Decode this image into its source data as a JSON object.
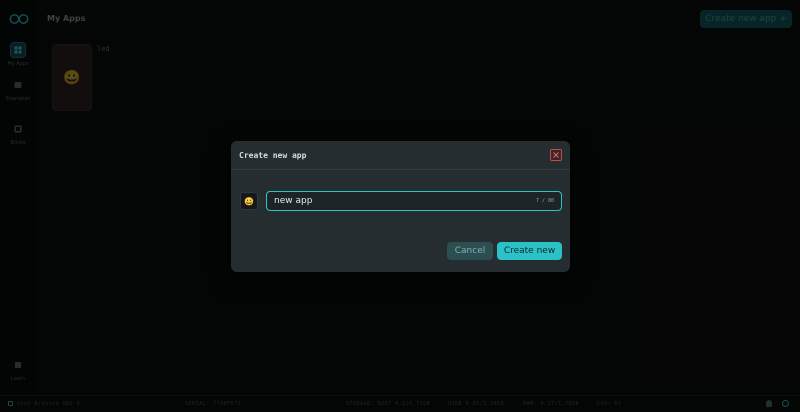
{
  "header": {
    "title": "My Apps",
    "create_button_label": "Create new app +"
  },
  "sidebar": {
    "items": [
      {
        "label": "My Apps",
        "icon": "grid-icon",
        "active": true
      },
      {
        "label": "Examples",
        "icon": "examples-icon",
        "active": false
      },
      {
        "label": "Bricks",
        "icon": "bricks-icon",
        "active": false
      }
    ],
    "bottom_item": {
      "label": "Learn",
      "icon": "book-icon"
    }
  },
  "apps": [
    {
      "name": "led",
      "emoji": "😀"
    }
  ],
  "statusbar": {
    "board": "UnoQ Arduino UNO Q",
    "serial": "SERIAL: 7740F673",
    "storage": "STORAGE: ROOT 4.2/6.72GB",
    "user": "USER 0.85/3.38GB",
    "ram": "RAM: 0.37/1.78GB",
    "cpu": "CPU: 6%"
  },
  "dialog": {
    "title": "Create new app",
    "emoji": "😀",
    "input_value": "new app",
    "char_count": "7 / 80",
    "cancel_label": "Cancel",
    "create_label": "Create new"
  },
  "colors": {
    "accent": "#2ac2c6",
    "close": "#c64b4b",
    "dialog_bg": "#262d31"
  }
}
